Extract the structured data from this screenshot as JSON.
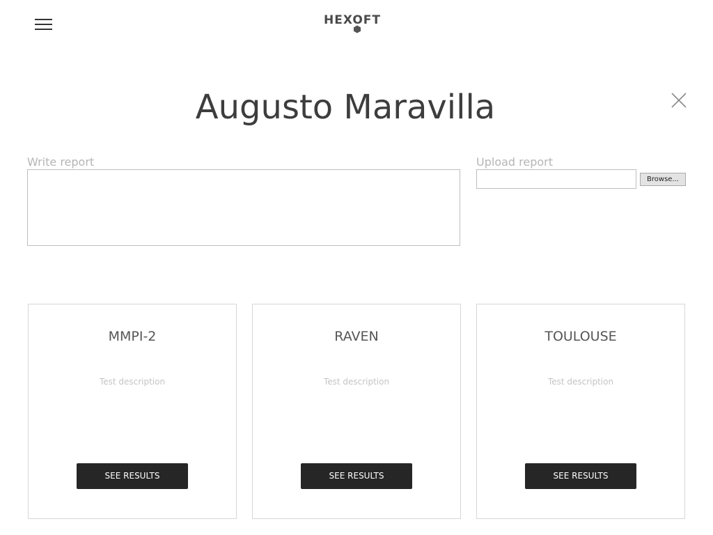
{
  "header": {
    "logo_text": "HEXOFT",
    "logo_icon": "hexagon-icon",
    "menu_icon": "hamburger-menu-icon",
    "close_icon": "close-icon"
  },
  "page": {
    "title": "Augusto Maravilla"
  },
  "report": {
    "write_label": "Write report",
    "write_value": "",
    "upload_label": "Upload report",
    "upload_value": "",
    "browse_label": "Browse..."
  },
  "tests": [
    {
      "name": "MMPI-2",
      "description": "Test description",
      "button_label": "SEE RESULTS"
    },
    {
      "name": "RAVEN",
      "description": "Test description",
      "button_label": "SEE RESULTS"
    },
    {
      "name": "TOULOUSE",
      "description": "Test description",
      "button_label": "SEE RESULTS"
    }
  ],
  "colors": {
    "button_bg": "#262626",
    "border": "#d6d6d6",
    "label_gray": "#b5b5b5"
  }
}
